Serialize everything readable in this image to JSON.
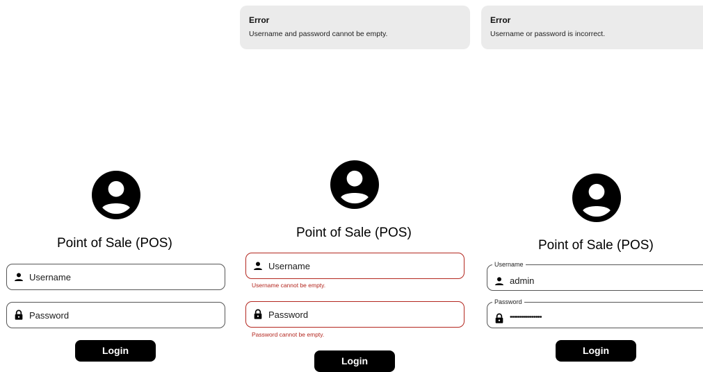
{
  "common": {
    "title": "Point of Sale (POS)",
    "username_placeholder": "Username",
    "password_placeholder": "Password",
    "login_label": "Login"
  },
  "screen_empty_error": {
    "toast": {
      "title": "Error",
      "message": "Username and password cannot be empty."
    },
    "username_error": "Username cannot be empty.",
    "password_error": "Password cannot be empty."
  },
  "screen_incorrect": {
    "toast": {
      "title": "Error",
      "message": "Username or password is incorrect."
    },
    "username_label": "Username",
    "username_value": "admin",
    "password_label": "Password",
    "password_value": "••••••••••••••••"
  },
  "icons": {
    "avatar": "account-circle-icon",
    "user": "person-icon",
    "lock": "lock-icon"
  },
  "colors": {
    "error": "#b3261e",
    "button": "#000000",
    "toast_bg": "#ebebeb"
  }
}
